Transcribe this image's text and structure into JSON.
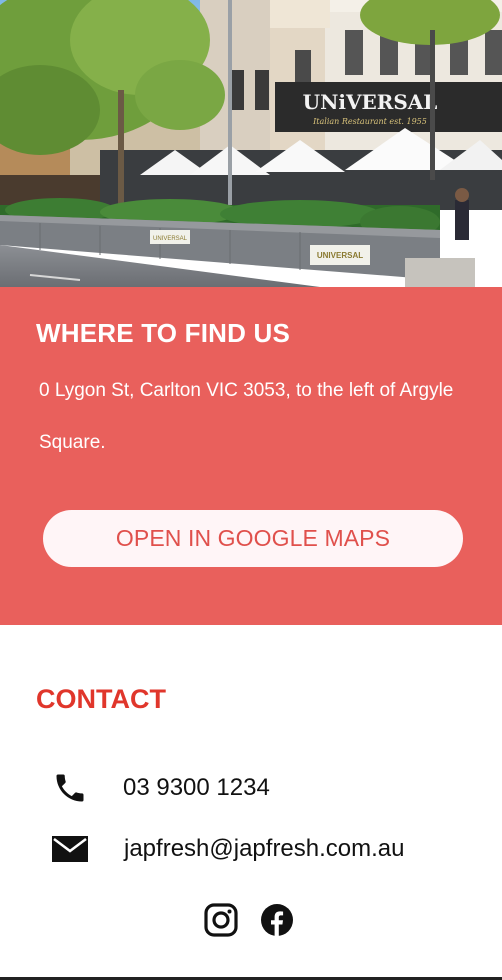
{
  "hero": {
    "sign_name": "UNiVERSAL",
    "sign_tagline": "Italian Restaurant est. 1955",
    "planter_sign": "UNIVERSAL"
  },
  "find_us": {
    "title": "WHERE TO FIND US",
    "address": "0 Lygon St, Carlton VIC 3053, to the left of Argyle Square.",
    "maps_button_label": "OPEN IN GOOGLE MAPS"
  },
  "contact": {
    "title": "CONTACT",
    "phone": "03 9300 1234",
    "email": "japfresh@japfresh.com.au",
    "icons": {
      "phone": "phone-icon",
      "email": "mail-icon",
      "instagram": "instagram-icon",
      "facebook": "facebook-icon"
    }
  },
  "colors": {
    "section_bg": "#e9605c",
    "button_bg": "#fff5f7",
    "accent_red": "#e0362b"
  }
}
